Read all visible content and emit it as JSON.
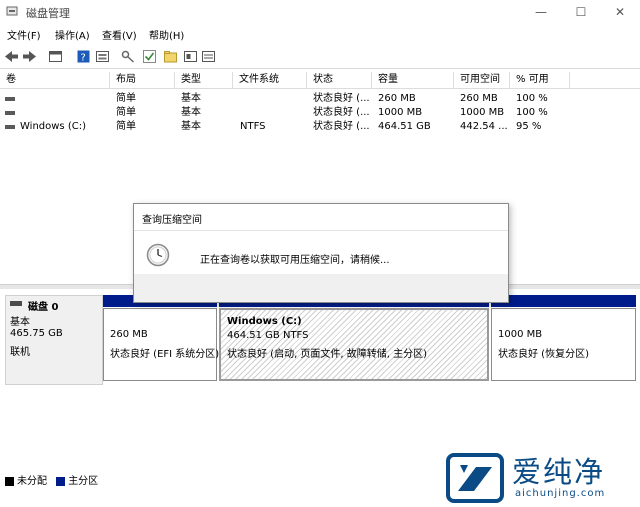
{
  "window": {
    "title": "磁盘管理",
    "min": "—",
    "max": "☐",
    "close": "✕"
  },
  "menu": [
    "文件(F)",
    "操作(A)",
    "查看(V)",
    "帮助(H)"
  ],
  "toolbar_icons": [
    "back-arrow-icon",
    "forward-arrow-icon",
    "properties-icon",
    "help-icon",
    "console-icon",
    "key-icon",
    "check-icon",
    "folder-icon",
    "disk-view-icon"
  ],
  "table": {
    "columns": [
      "卷",
      "布局",
      "类型",
      "文件系统",
      "状态",
      "容量",
      "可用空间",
      "% 可用"
    ],
    "rows": [
      [
        "",
        "简单",
        "基本",
        "",
        "状态良好 (...",
        "260 MB",
        "260 MB",
        "100 %"
      ],
      [
        "",
        "简单",
        "基本",
        "",
        "状态良好 (...",
        "1000 MB",
        "1000 MB",
        "100 %"
      ],
      [
        "Windows (C:)",
        "简单",
        "基本",
        "NTFS",
        "状态良好 (...",
        "464.51 GB",
        "442.54 ...",
        "95 %"
      ]
    ]
  },
  "disk": {
    "name": "磁盘 0",
    "type": "基本",
    "size": "465.75 GB",
    "status": "联机"
  },
  "partitions": [
    {
      "title": "",
      "size": "260 MB",
      "status": "状态良好 (EFI 系统分区)"
    },
    {
      "title": "Windows  (C:)",
      "size": "464.51 GB NTFS",
      "status": "状态良好 (启动, 页面文件, 故障转储, 主分区)"
    },
    {
      "title": "",
      "size": "1000 MB",
      "status": "状态良好 (恢复分区)"
    }
  ],
  "legend": [
    {
      "label": "未分配",
      "color": "#000000"
    },
    {
      "label": "主分区",
      "color": "#001c8a"
    }
  ],
  "dialog": {
    "title": "查询压缩空间",
    "message": "正在查询卷以获取可用压缩空间，请稍候..."
  },
  "watermark": {
    "brand": "爱纯净",
    "url": "aichunjing.com",
    "color": "#0a4b85"
  }
}
